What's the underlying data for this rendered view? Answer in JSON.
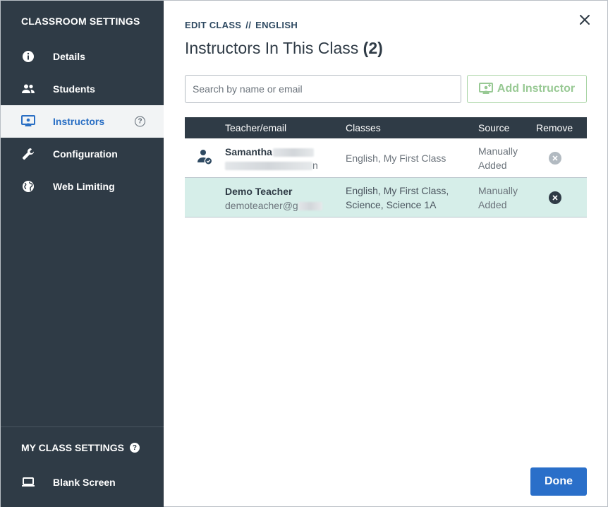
{
  "sidebar": {
    "heading": "CLASSROOM SETTINGS",
    "items": [
      {
        "label": "Details",
        "icon": "info-icon"
      },
      {
        "label": "Students",
        "icon": "people-icon"
      },
      {
        "label": "Instructors",
        "icon": "presenter-icon",
        "active": true
      },
      {
        "label": "Configuration",
        "icon": "wrench-icon"
      },
      {
        "label": "Web Limiting",
        "icon": "globe-icon"
      }
    ],
    "help_glyph": "?",
    "footer_heading": "MY CLASS SETTINGS",
    "footer_item": {
      "label": "Blank Screen",
      "icon": "laptop-icon"
    }
  },
  "header": {
    "breadcrumb": [
      "EDIT CLASS",
      "//",
      "ENGLISH"
    ],
    "title": "Instructors In This Class",
    "count": "(2)"
  },
  "search": {
    "placeholder": "Search by name or email",
    "value": ""
  },
  "add_button": {
    "label": "Add Instructor"
  },
  "table": {
    "headers": [
      "Teacher/email",
      "Classes",
      "Source",
      "Remove"
    ],
    "rows": [
      {
        "name": "Samantha",
        "email_suffix": "n",
        "classes": "English, My First Class",
        "source_line1": "Manually",
        "source_line2": "Added",
        "remove_enabled": false
      },
      {
        "name": "Demo Teacher",
        "email": "demoteacher@g",
        "classes_line1": "English, My First Class,",
        "classes_line2": "Science, Science 1A",
        "source_line1": "Manually",
        "source_line2": "Added",
        "remove_enabled": true
      }
    ]
  },
  "done_button": {
    "label": "Done"
  },
  "colors": {
    "sidebar_bg": "#2f3b46",
    "accent": "#2a6fc9",
    "highlight_row": "#d6eee9",
    "add_button": "#98c994"
  }
}
